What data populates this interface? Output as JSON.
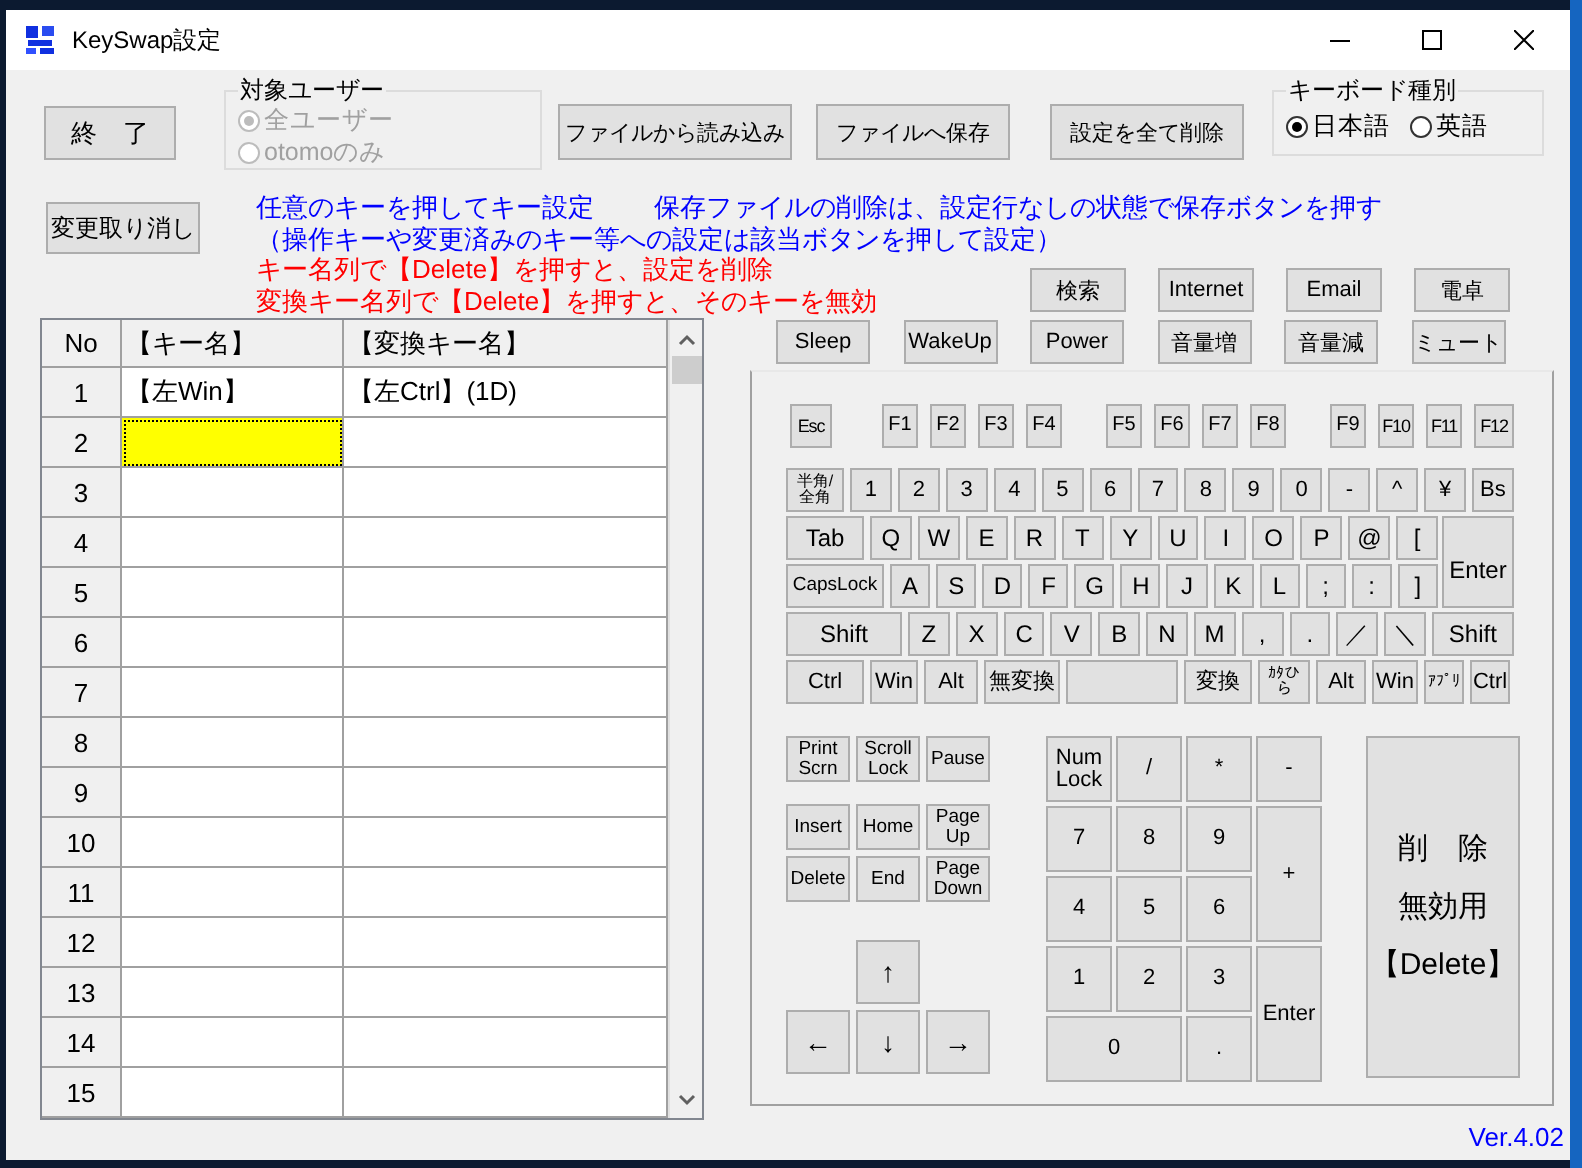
{
  "window": {
    "title": "KeySwap設定"
  },
  "exit_button": "終　了",
  "target_user": {
    "legend": "対象ユーザー",
    "disabled": true,
    "options": [
      {
        "label": "全ユーザー",
        "selected": true
      },
      {
        "label": "otomoのみ",
        "selected": false
      }
    ]
  },
  "file_buttons": [
    "ファイルから読み込み",
    "ファイルへ保存",
    "設定を全て削除"
  ],
  "keyboard_type": {
    "legend": "キーボード種別",
    "options": [
      {
        "label": "日本語",
        "selected": true
      },
      {
        "label": "英語",
        "selected": false
      }
    ]
  },
  "undo_button": "変更取り消し",
  "info_lines": [
    [
      "任意のキーを押してキー設定",
      "保存ファイルの削除は、設定行なしの状態で保存ボタンを押す"
    ],
    [
      "（操作キーや変更済みのキー等への設定は該当ボタンを押して設定）"
    ]
  ],
  "warning_lines": [
    "キー名列で【Delete】を押すと、設定を削除",
    "変換キー名列で【Delete】を押すと、そのキーを無効"
  ],
  "special_keys_row1": [
    "検索",
    "Internet",
    "Email",
    "電卓"
  ],
  "special_keys_row2": [
    "Sleep",
    "WakeUp",
    "Power",
    "音量増",
    "音量減",
    "ミュート"
  ],
  "table": {
    "columns": [
      "No",
      "【キー名】",
      "【変換キー名】"
    ],
    "rows": [
      {
        "no": "1",
        "key_name": "【左Win】",
        "mapped_key": "【左Ctrl】(1D)",
        "selected": false
      },
      {
        "no": "2",
        "selected": true
      },
      {
        "no": "3",
        "selected": false
      },
      {
        "no": "4",
        "selected": false
      },
      {
        "no": "5",
        "selected": false
      },
      {
        "no": "6",
        "selected": false
      },
      {
        "no": "7",
        "selected": false
      },
      {
        "no": "8",
        "selected": false
      },
      {
        "no": "9",
        "selected": false
      },
      {
        "no": "10",
        "selected": false
      },
      {
        "no": "11",
        "selected": false
      },
      {
        "no": "12",
        "selected": false
      },
      {
        "no": "13",
        "selected": false
      },
      {
        "no": "14",
        "selected": false
      },
      {
        "no": "15",
        "selected": false
      }
    ]
  },
  "keyboard": {
    "function_row": [
      "Esc",
      "F1",
      "F2",
      "F3",
      "F4",
      "F5",
      "F6",
      "F7",
      "F8",
      "F9",
      "F10",
      "F11",
      "F12"
    ],
    "number_row": [
      "半角/\n全角",
      "1",
      "2",
      "3",
      "4",
      "5",
      "6",
      "7",
      "8",
      "9",
      "0",
      "-",
      "^",
      "¥",
      "Bs"
    ],
    "qwerty_row": [
      "Tab",
      "Q",
      "W",
      "E",
      "R",
      "T",
      "Y",
      "U",
      "I",
      "O",
      "P",
      "@",
      "["
    ],
    "home_row": [
      "CapsLock",
      "A",
      "S",
      "D",
      "F",
      "G",
      "H",
      "J",
      "K",
      "L",
      ";",
      ":",
      "]"
    ],
    "enter": "Enter",
    "shift_row": [
      "Shift",
      "Z",
      "X",
      "C",
      "V",
      "B",
      "N",
      "M",
      ",",
      ".",
      "／",
      "＼",
      "Shift"
    ],
    "bottom_row": [
      "Ctrl",
      "Win",
      "Alt",
      "無変換",
      "変換",
      "ｶﾀひら",
      "Alt",
      "Win",
      "ｱﾌﾟﾘ",
      "Ctrl"
    ]
  },
  "nav_keys": [
    [
      "Print\nScrn",
      "Scroll\nLock",
      "Pause"
    ],
    [
      "Insert",
      "Home",
      "Page\nUp"
    ],
    [
      "Delete",
      "End",
      "Page\nDown"
    ]
  ],
  "arrow_keys": [
    "↑",
    "←",
    "↓",
    "→"
  ],
  "numpad": [
    "Num\nLock",
    "/",
    "*",
    "-",
    "7",
    "8",
    "9",
    "+",
    "4",
    "5",
    "6",
    "1",
    "2",
    "3",
    "Enter",
    "0",
    "."
  ],
  "delete_button": [
    "削　除",
    "無効用",
    "【Delete】"
  ],
  "version": "Ver.4.02"
}
